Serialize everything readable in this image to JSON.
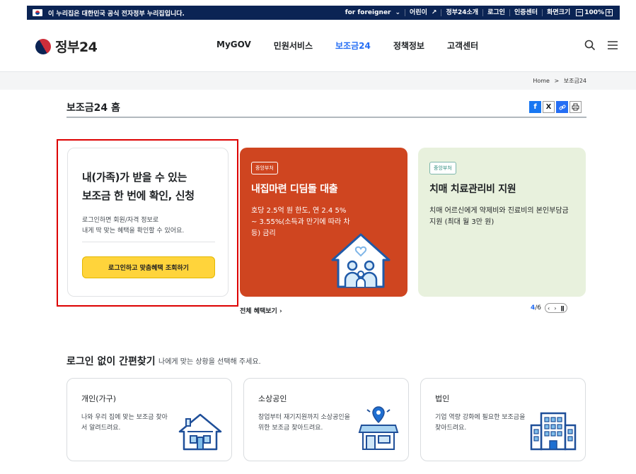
{
  "gov_bar": {
    "notice": "이 누리집은 대한민국 공식 전자정부 누리집입니다.",
    "links": [
      "for foreigner",
      "어린이",
      "정부24소개",
      "로그인",
      "인증센터",
      "화면크기"
    ],
    "zoom_minus": "−",
    "zoom_level": "100%",
    "zoom_plus": "+"
  },
  "header": {
    "logo_text": "정부24",
    "nav": [
      "MyGOV",
      "민원서비스",
      "보조금24",
      "정책정보",
      "고객센터"
    ],
    "active_nav": "보조금24",
    "search_icon": "⌕",
    "menu_icon": "☰"
  },
  "breadcrumb": {
    "home": "Home",
    "sep": ">",
    "current": "보조금24"
  },
  "page": {
    "title": "보조금24 홈"
  },
  "share": {
    "facebook": "f",
    "x": "X",
    "link": "🔗",
    "print": "⎙"
  },
  "login_card": {
    "headline_1": "내(가족)가 받을 수 있는",
    "headline_2": "보조금 한 번에 확인, 신청",
    "desc_1": "로그인하면 회원/자격 정보로",
    "desc_2": "내게 딱 맞는 혜택을 확인할 수 있어요.",
    "button": "로그인하고 맞춤혜택 조회하기"
  },
  "slides": [
    {
      "tag": "중앙부처",
      "title": "내집마련 디딤돌 대출",
      "desc": "호당 2.5억 원 한도, 연 2.4 5% ~ 3.55%(소득과 만기에 따라 차등) 금리"
    },
    {
      "tag": "중앙부처",
      "title": "치매 치료관리비 지원",
      "desc": "치매 어르신에게 약제비와 진료비의 본인부담금 지원 (최대 월 3만 원)"
    }
  ],
  "carousel": {
    "all_benefits": "전체 혜택보기 ›",
    "current": "4",
    "total": "/6",
    "prev": "‹",
    "next": "›",
    "pause": "⏸"
  },
  "quick": {
    "title": "로그인 없이 간편찾기",
    "subtitle": "나에게 맞는 상황을 선택해 주세요.",
    "cards": [
      {
        "title": "개인(가구)",
        "desc": "나와 우리 집에 맞는 보조금 찾아서 알려드려요."
      },
      {
        "title": "소상공인",
        "desc": "창업부터 재기지원까지 소상공인을 위한 보조금 찾아드려요."
      },
      {
        "title": "법인",
        "desc": "기업 역량 강화에 필요한 보조금을 찾아드려요."
      }
    ]
  },
  "colors": {
    "navy": "#0b2454",
    "accent": "#256ef4",
    "orange": "#cf4520",
    "green": "#e8f1dd",
    "yellow": "#ffd43b"
  }
}
